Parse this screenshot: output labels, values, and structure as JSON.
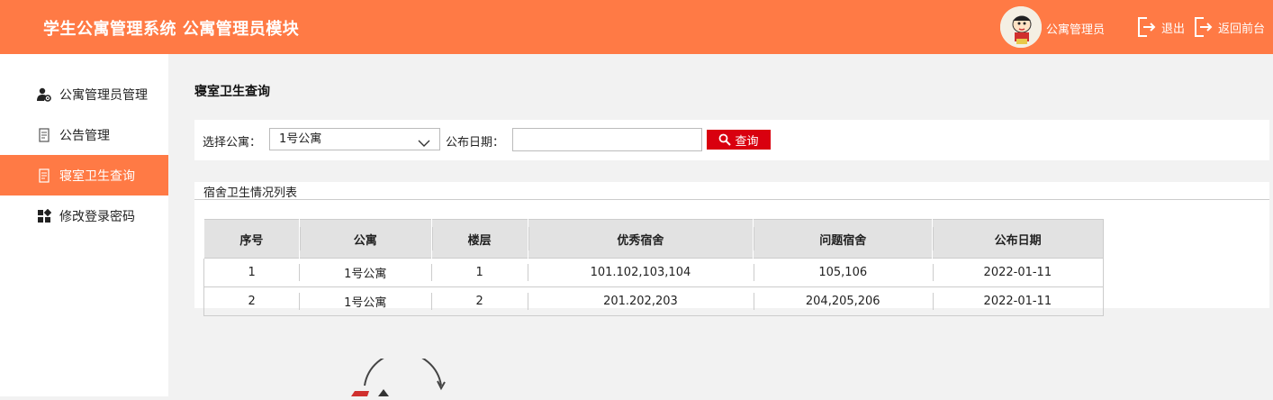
{
  "header": {
    "title": "学生公寓管理系统 公寓管理员模块",
    "user_name": "公寓管理员",
    "logout_label": "退出",
    "back_label": "返回前台",
    "bg_color": "#ff7a45"
  },
  "sidebar": {
    "items": [
      {
        "label": "公寓管理员管理",
        "icon": "user-settings-icon",
        "active": false
      },
      {
        "label": "公告管理",
        "icon": "document-icon",
        "active": false
      },
      {
        "label": "寝室卫生查询",
        "icon": "document-icon",
        "active": true
      },
      {
        "label": "修改登录密码",
        "icon": "grid-icon",
        "active": false
      }
    ]
  },
  "main": {
    "page_title": "寝室卫生查询",
    "search": {
      "apartment_label": "选择公寓：",
      "apartment_value": "1号公寓",
      "date_label": "公布日期：",
      "date_value": "",
      "query_label": "查询"
    },
    "list": {
      "title": "宿舍卫生情况列表",
      "columns": [
        "序号",
        "公寓",
        "楼层",
        "优秀宿舍",
        "问题宿舍",
        "公布日期"
      ],
      "rows": [
        [
          "1",
          "1号公寓",
          "1",
          "101.102,103,104",
          "105,106",
          "2022-01-11"
        ],
        [
          "2",
          "1号公寓",
          "2",
          "201.202,203",
          "204,205,206",
          "2022-01-11"
        ]
      ]
    }
  }
}
